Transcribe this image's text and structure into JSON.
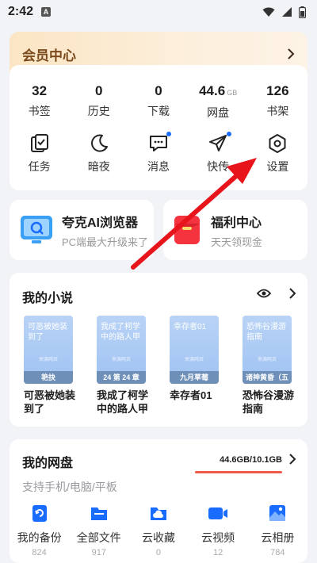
{
  "status": {
    "time": "2:42",
    "app_badge": "A"
  },
  "member": {
    "title": "会员中心"
  },
  "stats": [
    {
      "value": "32",
      "unit": "",
      "label": "书签"
    },
    {
      "value": "0",
      "unit": "",
      "label": "历史"
    },
    {
      "value": "0",
      "unit": "",
      "label": "下载"
    },
    {
      "value": "44.6",
      "unit": "GB",
      "label": "网盘"
    },
    {
      "value": "126",
      "unit": "",
      "label": "书架"
    }
  ],
  "tools": [
    {
      "label": "任务",
      "icon": "task-icon"
    },
    {
      "label": "暗夜",
      "icon": "moon-icon"
    },
    {
      "label": "消息",
      "icon": "message-icon"
    },
    {
      "label": "快传",
      "icon": "send-icon"
    },
    {
      "label": "设置",
      "icon": "settings-icon"
    }
  ],
  "promos": {
    "browser": {
      "title": "夸克AI浏览器",
      "subtitle": "PC端最大升级来了"
    },
    "welfare": {
      "title": "福利中心",
      "subtitle": "天天领现金"
    }
  },
  "novels": {
    "title": "我的小说",
    "cover_mark": "来源网页",
    "books": [
      {
        "cover_title": "可恶被她装到了",
        "band": "艳抉",
        "name": "可恶被她装到了"
      },
      {
        "cover_title": "我成了柯学中的路人甲",
        "band": "24 第 24 章",
        "name": "我成了柯学中的路人甲"
      },
      {
        "cover_title": "幸存者01",
        "band": "九月草莓",
        "name": "幸存者01"
      },
      {
        "cover_title": "恐怖谷漫游指南",
        "band": "诸神黄昏（五",
        "name": "恐怖谷漫游指南"
      }
    ]
  },
  "cloud": {
    "title": "我的网盘",
    "usage": "44.6GB/10.1GB",
    "subtitle": "支持手机/电脑/平板",
    "items": [
      {
        "label": "我的备份",
        "count": "824",
        "icon": "backup-icon"
      },
      {
        "label": "全部文件",
        "count": "917",
        "icon": "folder-icon"
      },
      {
        "label": "云收藏",
        "count": "0",
        "icon": "cloud-folder-icon"
      },
      {
        "label": "云视频",
        "count": "12",
        "icon": "video-icon"
      },
      {
        "label": "云相册",
        "count": "784",
        "icon": "photo-icon"
      }
    ]
  },
  "colors": {
    "accent_blue": "#1a6cff",
    "annotation_red": "#e8141b",
    "member_gold": "#7a4a1c"
  }
}
